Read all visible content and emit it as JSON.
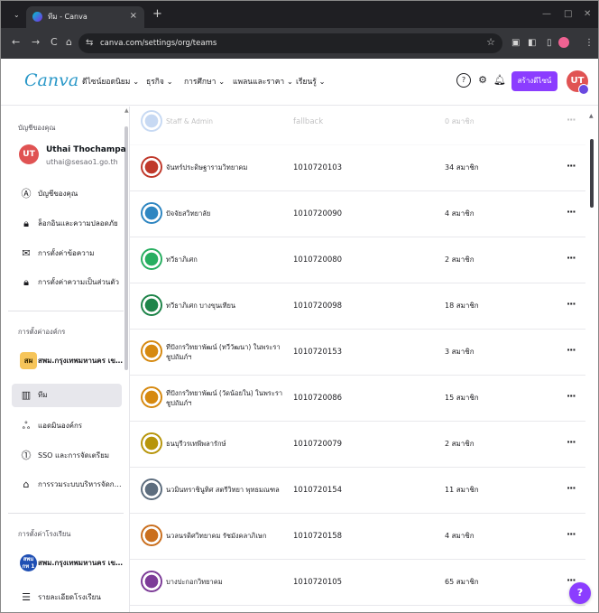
{
  "browser": {
    "tab_title": "ทีม - Canva",
    "tab_close": "×",
    "new_tab": "+",
    "url": "canva.com/settings/org/teams",
    "nav": {
      "back": "←",
      "forward": "→",
      "reload": "C",
      "home": "⌂"
    }
  },
  "header": {
    "logo": "Canva",
    "menu": [
      {
        "label": "ดีไซน์ยอดนิยม ⌄"
      },
      {
        "label": "ธุรกิจ ⌄"
      },
      {
        "label": "การศึกษา ⌄"
      },
      {
        "label": "แพลนและราคา ⌄"
      },
      {
        "label": "เรียนรู้ ⌄"
      }
    ],
    "create_button": "สร้างดีไซน์",
    "avatar_initials": "UT"
  },
  "sidebar": {
    "account_section_title": "บัญชีของคุณ",
    "user": {
      "initials": "UT",
      "name": "Uthai Thochampa",
      "email": "uthai@sesao1.go.th"
    },
    "account_items": [
      {
        "label": "บัญชีของคุณ"
      },
      {
        "label": "ล็อกอินและความปลอดภัย"
      },
      {
        "label": "การตั้งค่าข้อความ"
      },
      {
        "label": "การตั้งค่าความเป็นส่วนตัว"
      }
    ],
    "org_section_title": "การตั้งค่าองค์กร",
    "org": {
      "logo_text": "สผ",
      "name": "สพม.กรุงเทพมหานคร เข..."
    },
    "org_items": [
      {
        "label": "ทีม"
      },
      {
        "label": "แอดมินองค์กร"
      },
      {
        "label": "SSO และการจัดเตรียม"
      },
      {
        "label": "การรวมระบบบริหารจัดการ..."
      }
    ],
    "school_section_title": "การตั้งค่าโรงเรียน",
    "school": {
      "logo_text": "สพม กท 1",
      "name": "สพม.กรุงเทพมหานคร เข..."
    },
    "school_items": [
      {
        "label": "รายละเอียดโรงเรียน"
      }
    ]
  },
  "teams": {
    "rows": [
      {
        "name": "Staff & Admin",
        "id": "fallback",
        "members": "0 สมาชิก",
        "logo_color": "#3a7bd5"
      },
      {
        "name": "จันทร์ประดิษฐารามวิทยาคม",
        "id": "1010720103",
        "members": "34 สมาชิก",
        "logo_color": "#c0392b"
      },
      {
        "name": "ปัจจัยสวิทยาลัย",
        "id": "1010720090",
        "members": "4 สมาชิก",
        "logo_color": "#2e86c1"
      },
      {
        "name": "ทวีธาภิเศก",
        "id": "1010720080",
        "members": "2 สมาชิก",
        "logo_color": "#27ae60"
      },
      {
        "name": "ทวีธาภิเศก บางขุนเทียน",
        "id": "1010720098",
        "members": "18 สมาชิก",
        "logo_color": "#1e8449"
      },
      {
        "name": "ทีปังกรวิทยาพัฒน์ (ทวีวัฒนา) ในพระราชูปถัมภ์ฯ",
        "id": "1010720153",
        "members": "3 สมาชิก",
        "logo_color": "#d68910"
      },
      {
        "name": "ทีปังกรวิทยาพัฒน์ (วัดน้อยใน) ในพระราชูปถัมภ์ฯ",
        "id": "1010720086",
        "members": "15 สมาชิก",
        "logo_color": "#d68910"
      },
      {
        "name": "ธนบุรีวรเทพีพลารักษ์",
        "id": "1010720079",
        "members": "2 สมาชิก",
        "logo_color": "#b7950b"
      },
      {
        "name": "นวมินทราชินูทิศ สตรีวิทยา พุทธมณฑล",
        "id": "1010720154",
        "members": "11 สมาชิก",
        "logo_color": "#5d6d7e"
      },
      {
        "name": "นวลนรดิศวิทยาคม รัชมังคลาภิเษก",
        "id": "1010720158",
        "members": "4 สมาชิก",
        "logo_color": "#ca6f1e"
      },
      {
        "name": "บางปะกอกวิทยาคม",
        "id": "1010720105",
        "members": "65 สมาชิก",
        "logo_color": "#7d3c98"
      }
    ]
  },
  "help_fab": "?"
}
